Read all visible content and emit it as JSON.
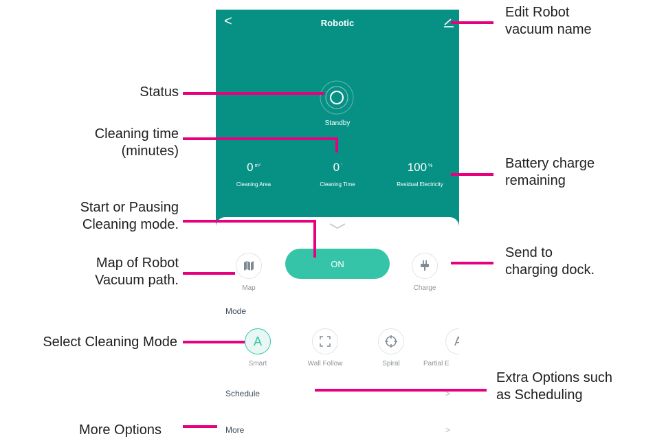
{
  "app": {
    "title": "Robotic",
    "back_glyph": "<",
    "status": "Standby",
    "stats": [
      {
        "value": "0",
        "unit": "m²",
        "label": "Cleaning Area"
      },
      {
        "value": "0",
        "unit": "′",
        "label": "Cleaning Time"
      },
      {
        "value": "100",
        "unit": "%",
        "label": "Residual Electricity"
      }
    ],
    "map_label": "Map",
    "on_label": "ON",
    "charge_label": "Charge",
    "mode_title": "Mode",
    "modes": [
      {
        "label": "Smart",
        "glyph": "A",
        "icon": "smart-icon",
        "selected": true
      },
      {
        "label": "Wall Follow",
        "glyph": "",
        "icon": "wall-follow-icon",
        "selected": false
      },
      {
        "label": "Spiral",
        "glyph": "",
        "icon": "spiral-icon",
        "selected": false
      },
      {
        "label": "Partial E",
        "glyph": "A",
        "icon": "partial-icon",
        "selected": false
      }
    ],
    "schedule_label": "Schedule",
    "more_label": "More",
    "arrow_glyph": ">",
    "accent": "#079185",
    "button_color": "#35c4a8"
  },
  "annotations": {
    "edit_name": [
      "Edit Robot",
      "vacuum name"
    ],
    "status": "Status",
    "cleaning_time": [
      "Cleaning time",
      "(minutes)"
    ],
    "battery": [
      "Battery charge",
      "remaining"
    ],
    "start_pause": [
      "Start or Pausing",
      "Cleaning mode."
    ],
    "map": [
      "Map of Robot",
      "Vacuum path."
    ],
    "charging": [
      "Send to",
      "charging dock."
    ],
    "select_mode": "Select Cleaning Mode",
    "extra_options": [
      "Extra Options such",
      "as Scheduling"
    ],
    "more_options": "More Options",
    "line_color": "#e6007e"
  }
}
